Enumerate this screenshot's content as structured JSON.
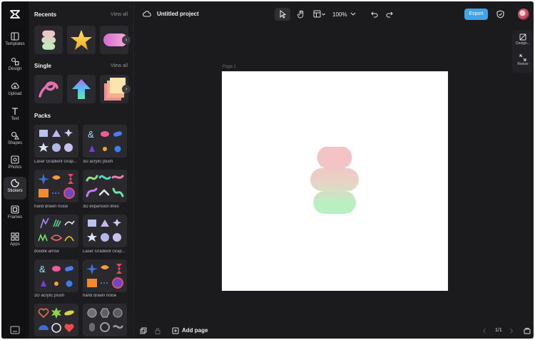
{
  "app": {
    "project_title": "Untitled project",
    "zoom": "100%",
    "export_label": "Export",
    "page_label": "Page 1",
    "add_page_label": "Add page",
    "page_count": "1/1"
  },
  "rail": {
    "items": [
      {
        "label": "Templates",
        "icon": "templates-icon"
      },
      {
        "label": "Design",
        "icon": "design-icon"
      },
      {
        "label": "Upload",
        "icon": "upload-icon"
      },
      {
        "label": "Text",
        "icon": "text-icon"
      },
      {
        "label": "Shapes",
        "icon": "shapes-icon"
      },
      {
        "label": "Photos",
        "icon": "photos-icon"
      },
      {
        "label": "Stickers",
        "icon": "stickers-icon",
        "active": true
      },
      {
        "label": "Frames",
        "icon": "frames-icon"
      },
      {
        "label": "Apps",
        "icon": "apps-icon"
      }
    ]
  },
  "panel": {
    "recents_title": "Recents",
    "single_title": "Single",
    "packs_title": "Packs",
    "view_all": "View all",
    "recents": [
      "flower-sticker",
      "star-sticker",
      "pill-sticker"
    ],
    "single": [
      "squiggle-sticker",
      "arrow-sticker",
      "layered-square-sticker"
    ],
    "packs": [
      {
        "label": "Laser Gradient Grap..."
      },
      {
        "label": "3D acrylic plush"
      },
      {
        "label": "hand drawn noise"
      },
      {
        "label": "3D expansion lines"
      },
      {
        "label": "doodle arrow"
      },
      {
        "label": "Laser Gradient Grap..."
      },
      {
        "label": "3D acrylic plush"
      },
      {
        "label": "hand drawn noise"
      },
      {
        "label": ""
      },
      {
        "label": ""
      }
    ]
  },
  "side_panel": {
    "design_label": "Design...",
    "resize_label": "Resize"
  },
  "colors": {
    "accent": "#3fa3e9",
    "background": "#1b1b1d",
    "sticker_top": "#f4c3c6",
    "sticker_bottom": "#b9f0c2"
  }
}
